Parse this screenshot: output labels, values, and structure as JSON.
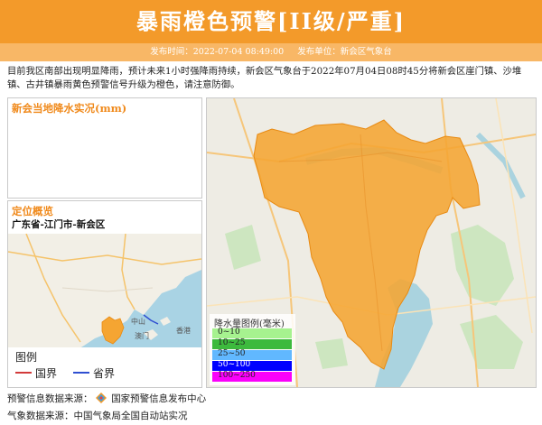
{
  "header": {
    "title": "暴雨橙色预警[II级/严重]",
    "publish_time_label": "发布时间：2022-07-04 08:49:00",
    "publish_unit_label": "发布单位：新会区气象台"
  },
  "description": "目前我区南部出现明显降雨，预计未来1小时强降雨持续，新会区气象台于2022年07月04日08时45分将新会区崖门镇、沙堆镇、古井镇暴雨黄色预警信号升级为橙色，请注意防御。",
  "rain_panel": {
    "title": "新会当地降水实况(mm)"
  },
  "locate_panel": {
    "title": "定位概览",
    "region": "广东省-江门市-新会区",
    "legend": {
      "title": "图例",
      "country_border": "国界",
      "province_border": "省界"
    },
    "map_labels": {
      "zhongshan": "中山",
      "aomen": "澳门",
      "xianggang": "香港"
    }
  },
  "rain_legend": {
    "title": "降水量图例(毫米)",
    "items": [
      {
        "label": "0~10",
        "color": "#a6f28f"
      },
      {
        "label": "10~25",
        "color": "#3dba3d"
      },
      {
        "label": "25~50",
        "color": "#61b8ff"
      },
      {
        "label": "50~100",
        "color": "#0000ff"
      },
      {
        "label": "100~250",
        "color": "#fa00fa"
      }
    ]
  },
  "footer": {
    "warning_source": "预警信息数据来源：",
    "warning_source_name": "国家预警信息发布中心",
    "weather_source": "气象数据来源：中国气象局全国自动站实况"
  },
  "colors": {
    "accent": "#f39a2a",
    "warning_area": "#f5a532"
  }
}
